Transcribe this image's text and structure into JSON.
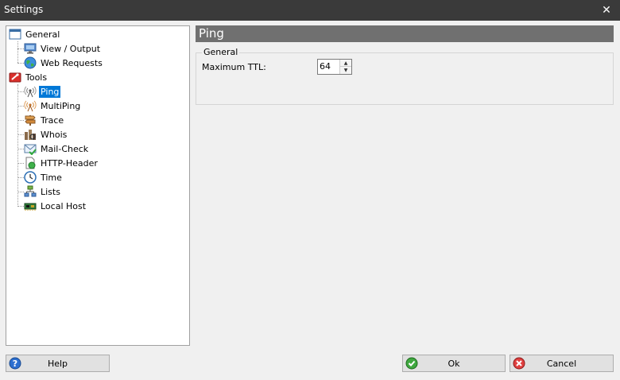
{
  "window": {
    "title": "Settings",
    "close_glyph": "✕"
  },
  "tree": {
    "items": [
      {
        "label": "General",
        "icon": "window-icon"
      },
      {
        "label": "View / Output",
        "icon": "monitor-icon"
      },
      {
        "label": "Web Requests",
        "icon": "globe-icon"
      },
      {
        "label": "Tools",
        "icon": "tools-icon"
      },
      {
        "label": "Ping",
        "icon": "ping-icon",
        "selected": true
      },
      {
        "label": "MultiPing",
        "icon": "multiping-icon"
      },
      {
        "label": "Trace",
        "icon": "signpost-icon"
      },
      {
        "label": "Whois",
        "icon": "whois-icon"
      },
      {
        "label": "Mail-Check",
        "icon": "mail-check-icon"
      },
      {
        "label": "HTTP-Header",
        "icon": "http-header-icon"
      },
      {
        "label": "Time",
        "icon": "clock-icon"
      },
      {
        "label": "Lists",
        "icon": "lists-icon"
      },
      {
        "label": "Local Host",
        "icon": "network-card-icon"
      }
    ]
  },
  "panel": {
    "header": "Ping",
    "group_title": "General",
    "ttl_label": "Maximum TTL:",
    "ttl_value": "64"
  },
  "buttons": {
    "help": "Help",
    "ok": "Ok",
    "cancel": "Cancel"
  },
  "colors": {
    "titlebar": "#3a3a3a",
    "selection": "#0078d7",
    "panel_header": "#707070"
  }
}
